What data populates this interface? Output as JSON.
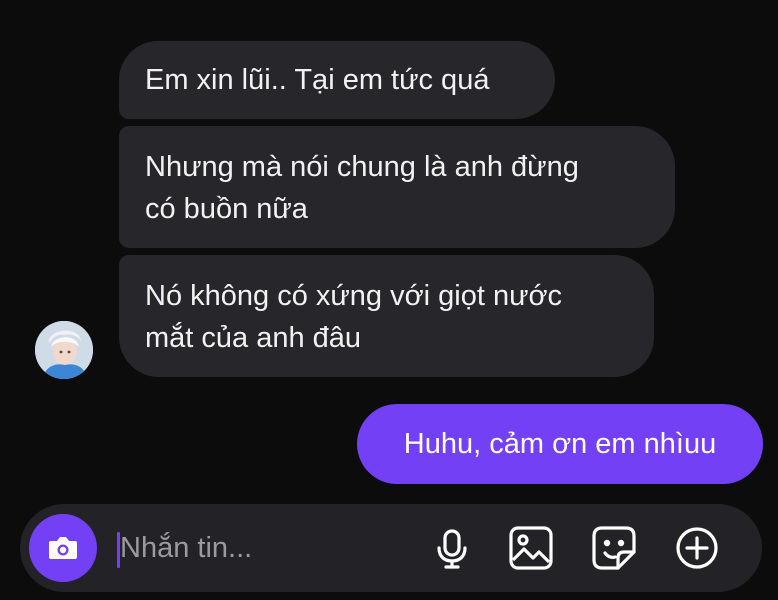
{
  "conversation": {
    "received_messages": [
      {
        "lines": [
          "Em xin lũi.. Tại em tức quá"
        ]
      },
      {
        "lines": [
          "Nhưng mà nói chung là anh đừng",
          "có buồn nữa"
        ]
      },
      {
        "lines": [
          "Nó không có xứng với giọt nước",
          "mắt của anh đâu"
        ]
      }
    ],
    "sent_messages": [
      {
        "text": "Huhu, cảm ơn em nhìuu"
      }
    ]
  },
  "composer": {
    "placeholder": "Nhắn tin...",
    "icons": [
      "camera-icon",
      "microphone-icon",
      "image-icon",
      "sticker-icon",
      "plus-circle-icon"
    ]
  },
  "colors": {
    "background": "#0c0c0d",
    "received_bubble": "#27262b",
    "sent_bubble": "#7440f5",
    "accent": "#7440f5",
    "composer": "#232227"
  }
}
